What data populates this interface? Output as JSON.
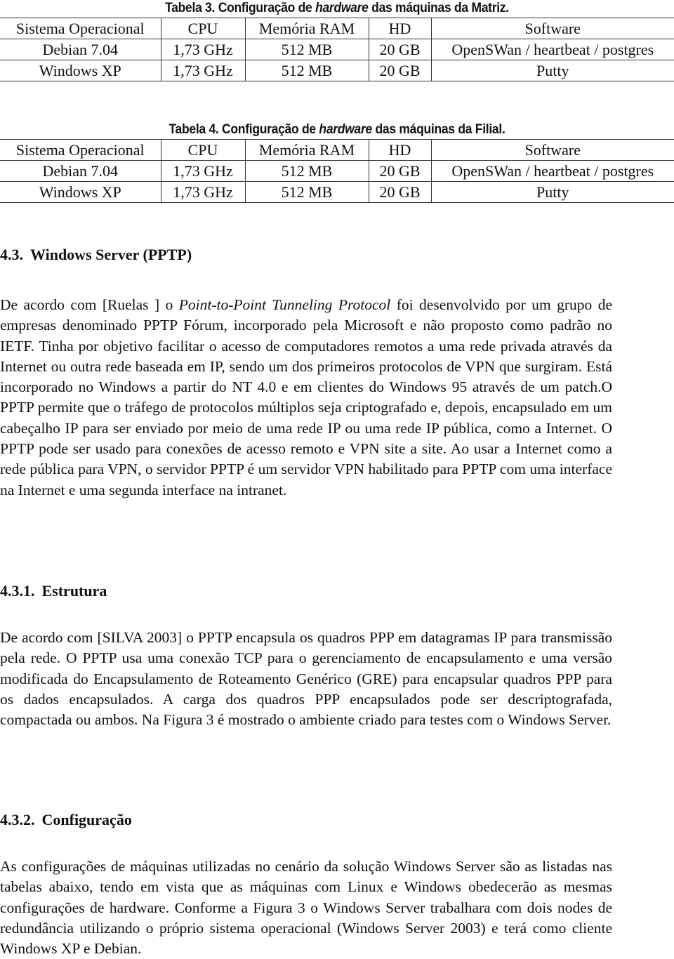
{
  "tables": [
    {
      "caption_prefix": "Tabela 3. Configuração de ",
      "caption_italic": "hardware",
      "caption_suffix": " das máquinas da Matriz.",
      "headers": [
        "Sistema Operacional",
        "CPU",
        "Memória RAM",
        "HD",
        "Software"
      ],
      "rows": [
        [
          "Debian 7.04",
          "1,73 GHz",
          "512 MB",
          "20 GB",
          "OpenSWan / heartbeat / postgres"
        ],
        [
          "Windows XP",
          "1,73 GHz",
          "512 MB",
          "20 GB",
          "Putty"
        ]
      ]
    },
    {
      "caption_prefix": "Tabela 4. Configuração de ",
      "caption_italic": "hardware",
      "caption_suffix": " das máquinas da Filial.",
      "headers": [
        "Sistema Operacional",
        "CPU",
        "Memória RAM",
        "HD",
        "Software"
      ],
      "rows": [
        [
          "Debian 7.04",
          "1,73 GHz",
          "512 MB",
          "20 GB",
          "OpenSWan / heartbeat / postgres"
        ],
        [
          "Windows XP",
          "1,73 GHz",
          "512 MB",
          "20 GB",
          "Putty"
        ]
      ]
    }
  ],
  "sections": [
    {
      "number": "4.3.",
      "title": "Windows Server (PPTP)",
      "paragraph": {
        "before_italic": "De acordo com [Ruelas ] o ",
        "italic": "Point-to-Point Tunneling Protocol",
        "after_italic": " foi desenvolvido por um grupo de empresas denominado PPTP Fórum, incorporado pela Microsoft e não proposto como padrão no IETF. Tinha por objetivo facilitar o acesso de computadores remotos a uma rede privada através da Internet ou outra rede baseada em IP, sendo um dos primeiros protocolos de VPN que surgiram. Está incorporado no Windows a partir do NT 4.0 e em clientes do Windows 95 através de um patch.O PPTP permite que o tráfego de protocolos múltiplos seja criptografado e, depois, encapsulado em um cabeçalho IP para ser enviado por meio de uma rede IP ou uma rede IP pública, como a Internet. O PPTP pode ser usado para conexões de acesso remoto e VPN site a site. Ao usar a Internet como a rede pública para VPN, o servidor PPTP é um servidor VPN habilitado para PPTP com uma interface na Internet e uma segunda interface na intranet."
      }
    },
    {
      "number": "4.3.1.",
      "title": "Estrutura",
      "paragraph": {
        "text": "De acordo com [SILVA 2003] o PPTP encapsula os quadros PPP em datagramas IP para transmissão pela rede. O PPTP usa uma conexão TCP para o gerenciamento de encap­sulamento e uma versão modificada do Encapsulamento de Roteamento Genérico (GRE) para encapsular quadros PPP para os dados encapsulados. A carga dos quadros PPP en­capsulados pode ser descriptografada, compactada ou ambos. Na Figura 3 é mostrado o ambiente criado para testes com o Windows Server."
      }
    },
    {
      "number": "4.3.2.",
      "title": "Configuração",
      "paragraph": {
        "text": "As configurações de máquinas utilizadas no cenário da solução Windows Server são as listadas nas tabelas abaixo, tendo em vista que as máquinas com Linux e Windows obe­decerão as mesmas configurações de hardware. Conforme a Figura 3 o Windows Server trabalhara com dois nodes de redundância utilizando o próprio sistema operacional (Win­dows Server 2003) e terá como cliente Windows XP e Debian."
      }
    }
  ]
}
